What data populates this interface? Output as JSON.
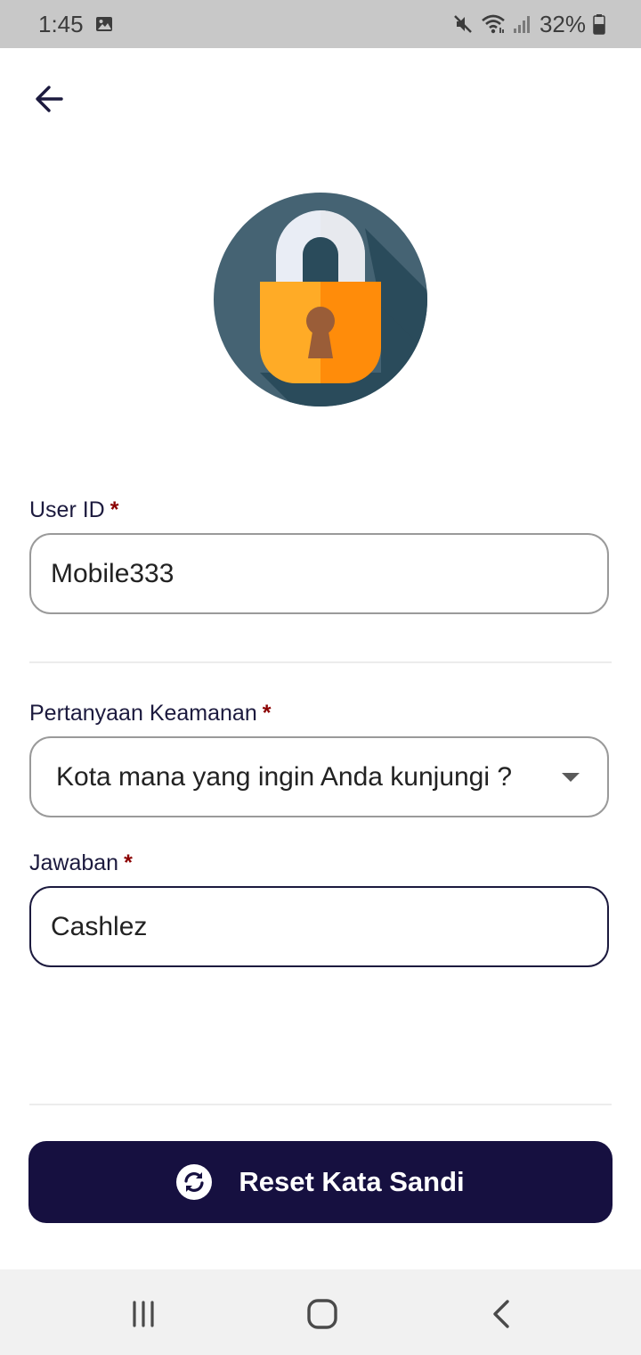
{
  "status_bar": {
    "time": "1:45",
    "battery": "32%",
    "icons": [
      "image-icon",
      "mute-icon",
      "wifi-icon",
      "signal-icon",
      "battery-icon"
    ]
  },
  "header": {
    "back_icon": "arrow-left-icon"
  },
  "hero": {
    "icon": "padlock-icon",
    "colors": {
      "circle": "#456373",
      "shadow": "#2a4b5b",
      "shackle": "#e9edf5",
      "body_left": "#ffab26",
      "body_right": "#ff8c0a",
      "keyhole": "#9a5d38"
    }
  },
  "form": {
    "user_id": {
      "label": "User ID",
      "required_mark": "*",
      "value": "Mobile333"
    },
    "security_question": {
      "label": "Pertanyaan Keamanan",
      "required_mark": "*",
      "selected": "Kota mana yang ingin Anda kunjungi ?"
    },
    "answer": {
      "label": "Jawaban",
      "required_mark": "*",
      "value": "Cashlez"
    }
  },
  "actions": {
    "reset_label": "Reset Kata Sandi",
    "reset_icon": "refresh-icon",
    "color": "#161040"
  },
  "nav_bar": {
    "items": [
      "recent-apps-icon",
      "home-icon",
      "back-icon"
    ]
  }
}
